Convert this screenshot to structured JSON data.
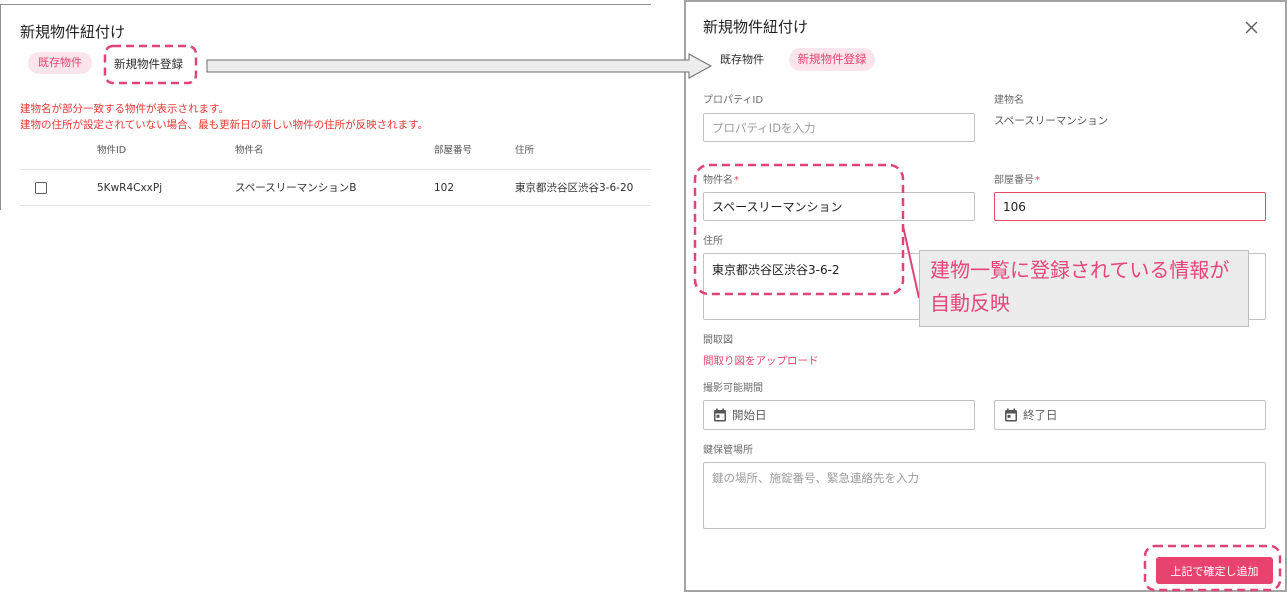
{
  "colors": {
    "accent": "#e8436f",
    "accent_soft": "#fce4ec",
    "notice_text": "#e53935",
    "field_highlight_border": "#e24d63",
    "annotation": "#e0437a",
    "callout_text": "#e6457c",
    "callout_background": "#ececec"
  },
  "left_dialog": {
    "title": "新規物件紐付け",
    "tabs": [
      {
        "label": "既存物件",
        "active": true
      },
      {
        "label": "新規物件登録",
        "active": false
      }
    ],
    "notes": [
      "建物名が部分一致する物件が表示されます。",
      "建物の住所が設定されていない場合、最も更新日の新しい物件の住所が反映されます。"
    ],
    "table": {
      "columns": [
        "物件ID",
        "物件名",
        "部屋番号",
        "住所"
      ],
      "rows": [
        {
          "checked": false,
          "property_id": "5KwR4CxxPj",
          "property_name": "スペースリーマンションB",
          "room_number": "102",
          "address": "東京都渋谷区渋谷3-6-20"
        }
      ]
    }
  },
  "right_dialog": {
    "title": "新規物件紐付け",
    "close_icon": "close-icon",
    "tabs": [
      {
        "label": "既存物件",
        "active": false
      },
      {
        "label": "新規物件登録",
        "active": true
      }
    ],
    "form": {
      "property_id": {
        "label": "プロパティID",
        "placeholder": "プロパティIDを入力"
      },
      "building_name": {
        "label": "建物名",
        "value": "スペースリーマンション"
      },
      "property_name": {
        "label": "物件名",
        "required_mark": "*",
        "value": "スペースリーマンション"
      },
      "room_number": {
        "label": "部屋番号",
        "required_mark": "*",
        "value": "106"
      },
      "address": {
        "label": "住所",
        "value": "東京都渋谷区渋谷3-6-2"
      },
      "floor_plan": {
        "label": "間取図",
        "upload_link": "間取り図をアップロード"
      },
      "shooting_period": {
        "label": "撮影可能期間",
        "icon": "calendar-icon",
        "start_placeholder": "開始日",
        "end_placeholder": "終了日"
      },
      "key_storage": {
        "label": "鍵保管場所",
        "placeholder": "鍵の場所、施錠番号、緊急連絡先を入力"
      }
    },
    "submit_button": "上記で確定し追加"
  },
  "annotation": {
    "callout_lines": [
      "建物一覧に登録されている情報が",
      "自動反映"
    ]
  }
}
